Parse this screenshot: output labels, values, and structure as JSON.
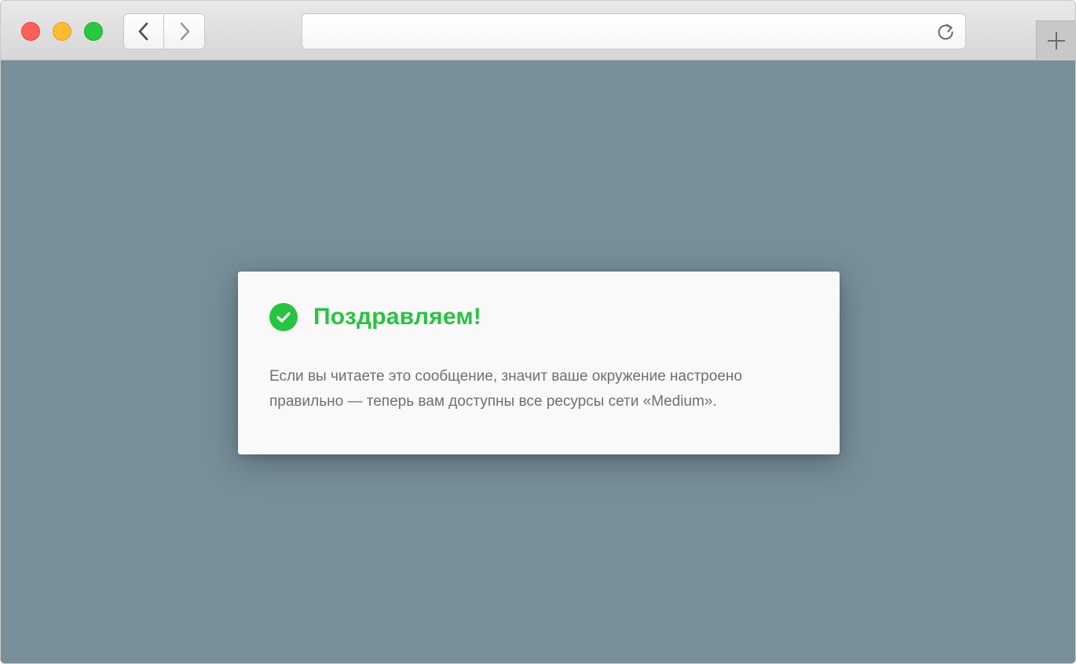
{
  "browser": {
    "address_value": "",
    "icons": {
      "back": "chevron-left-icon",
      "forward": "chevron-right-icon",
      "reload": "reload-icon",
      "new_tab": "plus-icon"
    },
    "traffic_lights": {
      "close_color": "#fe5f57",
      "minimize_color": "#febc2e",
      "maximize_color": "#28c840"
    }
  },
  "page": {
    "background_color": "#788f99",
    "card": {
      "title": "Поздравляем!",
      "message": "Если вы читаете это сообщение, значит ваше окружение настроено правильно — теперь вам доступны все ресурсы сети «Medium».",
      "accent_color": "#27c43f",
      "icon": "check-circle-icon"
    }
  }
}
